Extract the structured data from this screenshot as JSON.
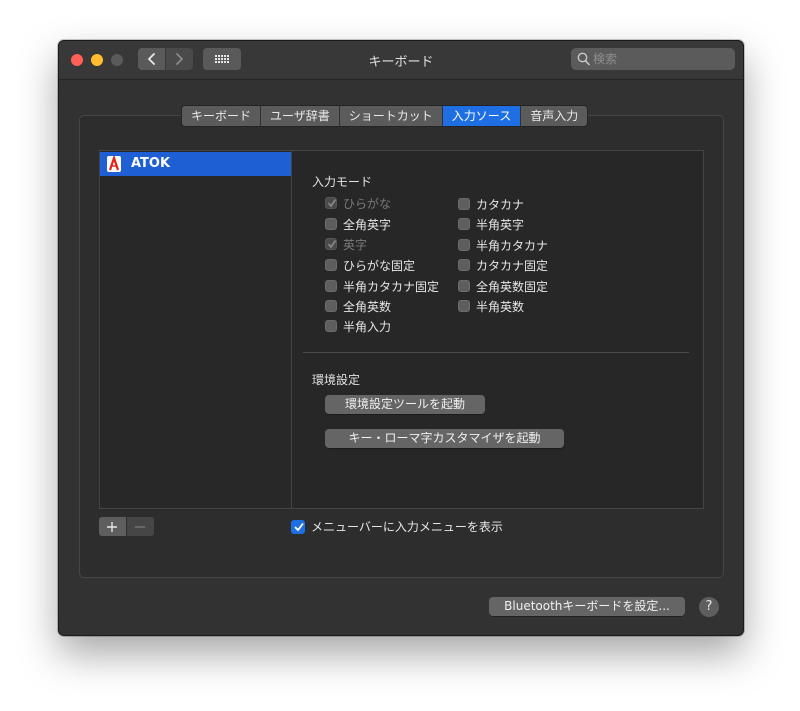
{
  "window": {
    "title": "キーボード"
  },
  "search": {
    "placeholder": "検索"
  },
  "tabs": [
    {
      "label": "キーボード",
      "active": false
    },
    {
      "label": "ユーザ辞書",
      "active": false
    },
    {
      "label": "ショートカット",
      "active": false
    },
    {
      "label": "入力ソース",
      "active": true
    },
    {
      "label": "音声入力",
      "active": false
    }
  ],
  "sources": [
    {
      "label": "ATOK",
      "selected": true
    }
  ],
  "input_modes": {
    "title": "入力モード",
    "left": [
      {
        "label": "ひらがな",
        "checked": true,
        "disabled": true
      },
      {
        "label": "全角英字",
        "checked": false,
        "disabled": false
      },
      {
        "label": "英字",
        "checked": true,
        "disabled": true
      },
      {
        "label": "ひらがな固定",
        "checked": false,
        "disabled": false
      },
      {
        "label": "半角カタカナ固定",
        "checked": false,
        "disabled": false
      },
      {
        "label": "全角英数",
        "checked": false,
        "disabled": false
      },
      {
        "label": "半角入力",
        "checked": false,
        "disabled": false
      }
    ],
    "right": [
      {
        "label": "カタカナ",
        "checked": false,
        "disabled": false
      },
      {
        "label": "半角英字",
        "checked": false,
        "disabled": false
      },
      {
        "label": "半角カタカナ",
        "checked": false,
        "disabled": false
      },
      {
        "label": "カタカナ固定",
        "checked": false,
        "disabled": false
      },
      {
        "label": "全角英数固定",
        "checked": false,
        "disabled": false
      },
      {
        "label": "半角英数",
        "checked": false,
        "disabled": false
      }
    ]
  },
  "preferences": {
    "title": "環境設定",
    "launch_tool_button": "環境設定ツールを起動",
    "romaji_customizer_button": "キー・ローマ字カスタマイザを起動"
  },
  "menu_checkbox": {
    "label": "メニューバーに入力メニューを表示",
    "checked": true
  },
  "bluetooth_button": "Bluetoothキーボードを設定...",
  "help_label": "?",
  "colors": {
    "accent": "#1f6fe4",
    "window_bg": "#323232"
  }
}
